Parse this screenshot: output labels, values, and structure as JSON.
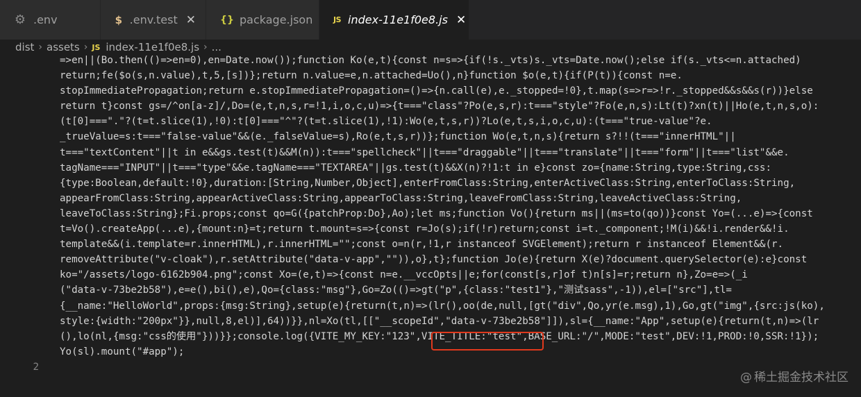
{
  "tabs": [
    {
      "icon": "gear-icon",
      "label": ".env",
      "active": false,
      "closable": false
    },
    {
      "icon": "dollar-icon",
      "label": ".env.test",
      "active": false,
      "closable": true
    },
    {
      "icon": "braces-icon",
      "label": "package.json",
      "active": false,
      "closable": false
    },
    {
      "icon": "js-file-icon",
      "label": "index-11e1f0e8.js",
      "active": true,
      "closable": true
    }
  ],
  "tab_icons": {
    "gear": "⚙",
    "dollar": "$",
    "braces": "{}",
    "js": "JS",
    "close": "✕"
  },
  "breadcrumb": {
    "parts": [
      "dist",
      "assets"
    ],
    "separator": "›",
    "file_icon": "JS",
    "file": "index-11e1f0e8.js",
    "tail": "..."
  },
  "editor": {
    "code_lines": [
      "=>en||(Bo.then(()=>en=0),en=Date.now());function Ko(e,t){const n=s=>{if(!s._vts)s._vts=Date.now();else if(s._vts<=n.attached)",
      "return;fe($o(s,n.value),t,5,[s])};return n.value=e,n.attached=Uo(),n}function $o(e,t){if(P(t)){const n=e.",
      "stopImmediatePropagation;return e.stopImmediatePropagation=()=>{n.call(e),e._stopped=!0},t.map(s=>r=>!r._stopped&&s&&s(r))}else",
      "return t}const gs=/^on[a-z]/,Do=(e,t,n,s,r=!1,i,o,c,u)=>{t===\"class\"?Po(e,s,r):t===\"style\"?Fo(e,n,s):Lt(t)?xn(t)||Ho(e,t,n,s,o):",
      "(t[0]===\".\"?(t=t.slice(1),!0):t[0]===\"^\"?(t=t.slice(1),!1):Wo(e,t,s,r))?Lo(e,t,s,i,o,c,u):(t===\"true-value\"?e.",
      "_trueValue=s:t===\"false-value\"&&(e._falseValue=s),Ro(e,t,s,r))};function Wo(e,t,n,s){return s?!!(t===\"innerHTML\"||",
      "t===\"textContent\"||t in e&&gs.test(t)&&M(n)):t===\"spellcheck\"||t===\"draggable\"||t===\"translate\"||t===\"form\"||t===\"list\"&&e.",
      "tagName===\"INPUT\"||t===\"type\"&&e.tagName===\"TEXTAREA\"||gs.test(t)&&X(n)?!1:t in e}const zo={name:String,type:String,css:",
      "{type:Boolean,default:!0},duration:[String,Number,Object],enterFromClass:String,enterActiveClass:String,enterToClass:String,",
      "appearFromClass:String,appearActiveClass:String,appearToClass:String,leaveFromClass:String,leaveActiveClass:String,",
      "leaveToClass:String};Fi.props;const qo=G({patchProp:Do},Ao);let ms;function Vo(){return ms||(ms=to(qo))}const Yo=(...e)=>{const",
      "t=Vo().createApp(...e),{mount:n}=t;return t.mount=s=>{const r=Jo(s);if(!r)return;const i=t._component;!M(i)&&!i.render&&!i.",
      "template&&(i.template=r.innerHTML),r.innerHTML=\"\";const o=n(r,!1,r instanceof SVGElement);return r instanceof Element&&(r.",
      "removeAttribute(\"v-cloak\"),r.setAttribute(\"data-v-app\",\"\")),o},t};function Jo(e){return X(e)?document.querySelector(e):e}const",
      "ko=\"/assets/logo-6162b904.png\";const Xo=(e,t)=>{const n=e.__vccOpts||e;for(const[s,r]of t)n[s]=r;return n},Zo=e=>(_i",
      "(\"data-v-73be2b58\"),e=e(),bi(),e),Qo={class:\"msg\"},Go=Zo(()=>gt(\"p\",{class:\"test1\"},\"测试sass\",-1)),el=[\"src\"],tl=",
      "{__name:\"HelloWorld\",props:{msg:String},setup(e){return(t,n)=>(lr(),oo(de,null,[gt(\"div\",Qo,yr(e.msg),1),Go,gt(\"img\",{src:js(ko),",
      "style:{width:\"200px\"}},null,8,el)],64))}},nl=Xo(tl,[[\"__scopeId\",\"data-v-73be2b58\"]]),sl={__name:\"App\",setup(e){return(t,n)=>(lr",
      "(),lo(nl,{msg:\"css的使用\"}))}};console.log({VITE_MY_KEY:\"123\",VITE_TITLE:\"test\",BASE_URL:\"/\",MODE:\"test\",DEV:!1,PROD:!0,SSR:!1});",
      "Yo(sl).mount(\"#app\");"
    ],
    "line_number": "2"
  },
  "watermark": {
    "icon": "@",
    "text": "稀土掘金技术社区"
  },
  "colors": {
    "editor_bg": "#1e1e1e",
    "tabbar_bg": "#252526",
    "highlight_border": "#e1391d"
  }
}
